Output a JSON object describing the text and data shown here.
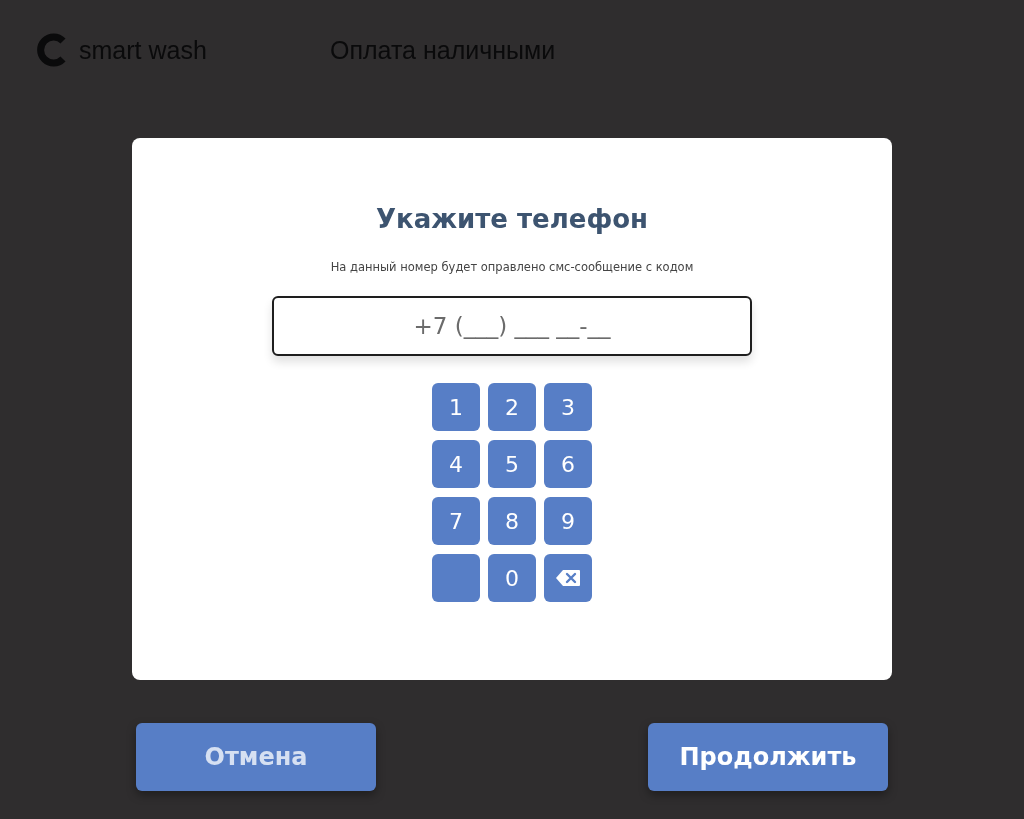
{
  "header": {
    "logo_text": "smart wash",
    "title": "Оплата наличными"
  },
  "dialog": {
    "title": "Укажите телефон",
    "subtitle": "На данный номер будет оправлено смс-сообщение с кодом",
    "phone": {
      "placeholder": "+7 (___) ___ __-__"
    },
    "keys": [
      {
        "kind": "digit",
        "label": "1"
      },
      {
        "kind": "digit",
        "label": "2"
      },
      {
        "kind": "digit",
        "label": "3"
      },
      {
        "kind": "digit",
        "label": "4"
      },
      {
        "kind": "digit",
        "label": "5"
      },
      {
        "kind": "digit",
        "label": "6"
      },
      {
        "kind": "digit",
        "label": "7"
      },
      {
        "kind": "digit",
        "label": "8"
      },
      {
        "kind": "digit",
        "label": "9"
      },
      {
        "kind": "blank"
      },
      {
        "kind": "digit",
        "label": "0"
      },
      {
        "kind": "backspace"
      }
    ]
  },
  "buttons": [
    {
      "kind": "secondary",
      "label": "Отмена"
    },
    {
      "kind": "primary",
      "label": "Продолжить"
    }
  ]
}
